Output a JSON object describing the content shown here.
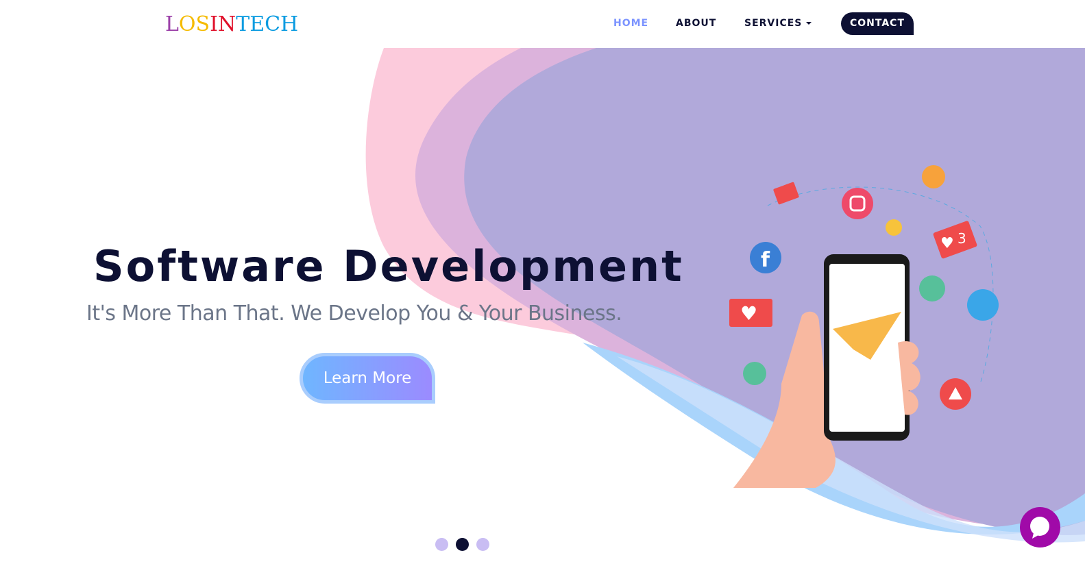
{
  "header": {
    "logo": {
      "letters": [
        {
          "t": "L",
          "c": "#9b3fa8"
        },
        {
          "t": "OS",
          "c": "#f5bb00"
        },
        {
          "t": "IN",
          "c": "#e0102a"
        },
        {
          "t": "TECH",
          "c": "#0a9be0"
        }
      ]
    },
    "nav": {
      "home": "HOME",
      "about": "ABOUT",
      "services": "SERVICES",
      "contact": "CONTACT"
    }
  },
  "hero": {
    "title": "Software Development",
    "subtitle": "It's More Than That. We Develop You & Your Business.",
    "button": "Learn More",
    "badge_count": "3"
  },
  "carousel": {
    "slides": 3,
    "active": 2
  },
  "colors": {
    "accent": "#0d1033",
    "home": "#7b93ff",
    "chat": "#a00aa8"
  }
}
